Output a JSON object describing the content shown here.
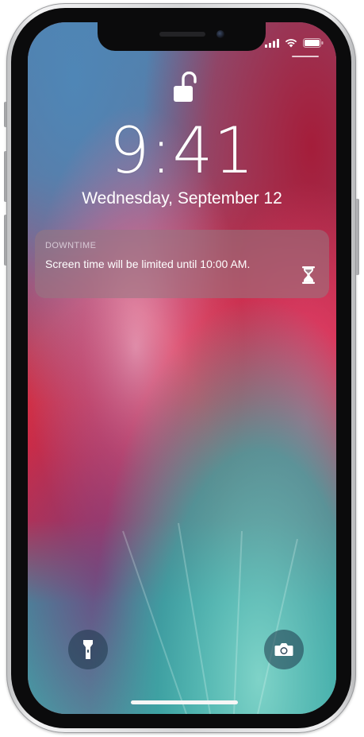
{
  "status_bar": {
    "icons": [
      "cellular-signal-icon",
      "wifi-icon",
      "battery-icon"
    ]
  },
  "lock_screen": {
    "lock_icon": "unlocked-padlock-icon",
    "time": "9:41",
    "date": "Wednesday, September 12"
  },
  "notification": {
    "app_name": "DOWNTIME",
    "message": "Screen time will be limited until 10:00 AM.",
    "icon": "hourglass-icon"
  },
  "quick_actions": {
    "left_icon": "flashlight-icon",
    "right_icon": "camera-icon"
  },
  "colors": {
    "wallpaper_red": "#e8283a",
    "wallpaper_teal": "#3fa7a6",
    "wallpaper_blue": "#4a7aa6",
    "text": "#ffffff"
  }
}
